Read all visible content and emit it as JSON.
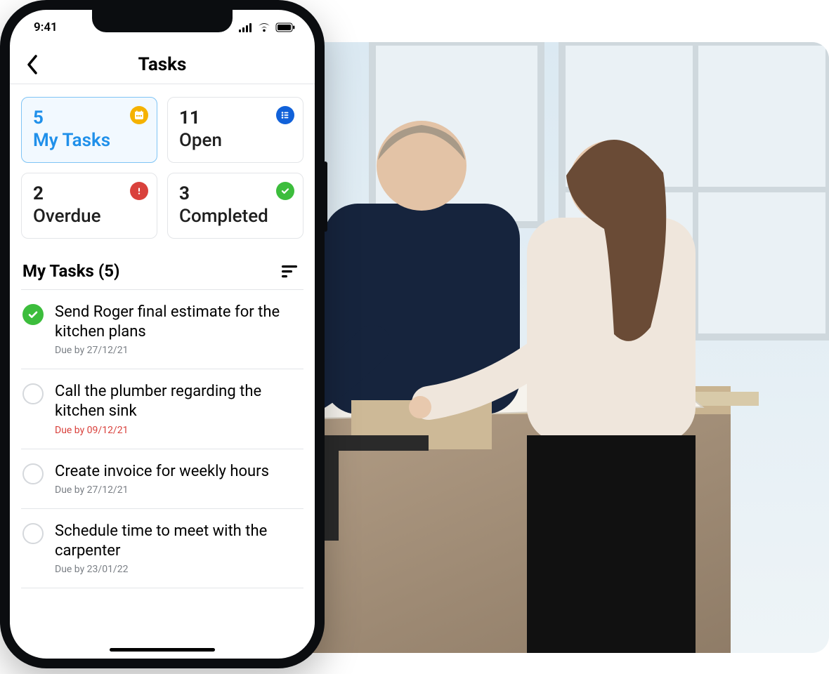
{
  "status_bar": {
    "time": "9:41"
  },
  "header": {
    "title": "Tasks"
  },
  "cards": [
    {
      "count": "5",
      "label": "My Tasks",
      "icon": "calendar-icon",
      "icon_bg": "#f5b200",
      "active": true
    },
    {
      "count": "11",
      "label": "Open",
      "icon": "list-icon",
      "icon_bg": "#1161d9",
      "active": false
    },
    {
      "count": "2",
      "label": "Overdue",
      "icon": "alert-icon",
      "icon_bg": "#d9413c",
      "active": false
    },
    {
      "count": "3",
      "label": "Completed",
      "icon": "check-icon",
      "icon_bg": "#3cbd3c",
      "active": false
    }
  ],
  "section": {
    "title": "My Tasks (5)"
  },
  "tasks": [
    {
      "title": "Send Roger final estimate for the kitchen plans",
      "due": "Due by 27/12/21",
      "done": true,
      "overdue": false
    },
    {
      "title": "Call the plumber regarding the kitchen sink",
      "due": "Due by 09/12/21",
      "done": false,
      "overdue": true
    },
    {
      "title": "Create invoice for weekly hours",
      "due": "Due by 27/12/21",
      "done": false,
      "overdue": false
    },
    {
      "title": "Schedule time to meet with the carpenter",
      "due": "Due by 23/01/22",
      "done": false,
      "overdue": false
    }
  ]
}
